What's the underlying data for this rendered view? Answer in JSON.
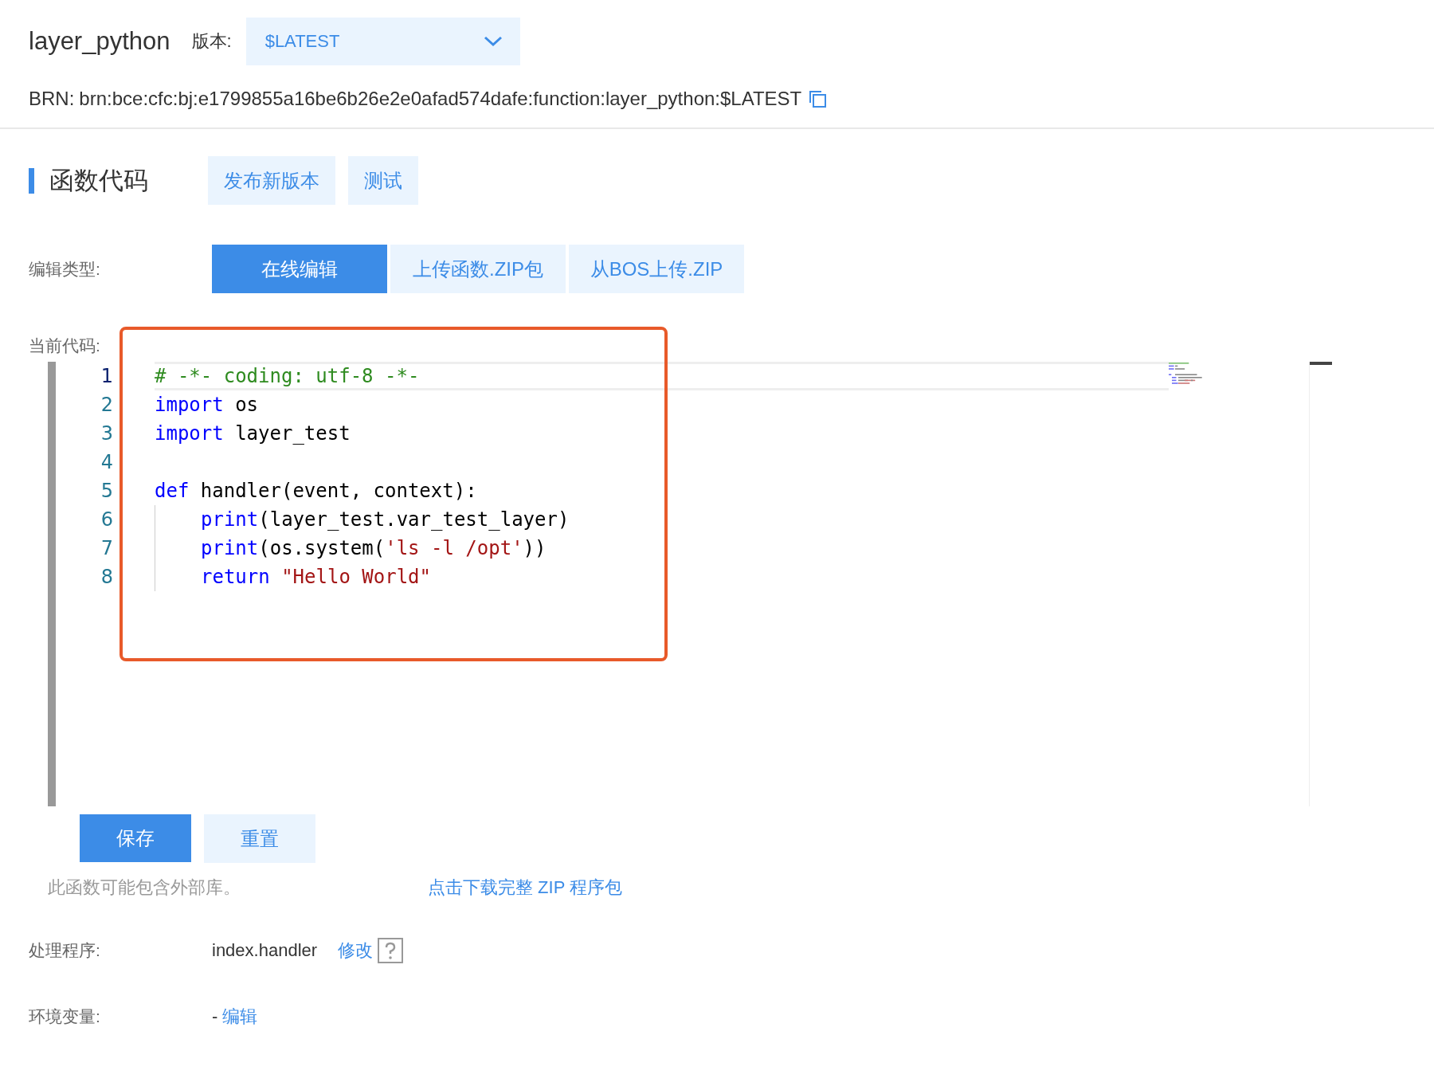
{
  "header": {
    "function_name": "layer_python",
    "version_label": "版本:",
    "version": {
      "value": "$LATEST"
    },
    "brn_label": "BRN:",
    "brn": "brn:bce:cfc:bj:e1799855a16be6b26e2e0afad574dafe:function:layer_python:$LATEST"
  },
  "section": {
    "title": "函数代码",
    "actions": [
      "发布新版本",
      "测试"
    ]
  },
  "edit_type": {
    "label": "编辑类型:",
    "tabs": [
      {
        "label": "在线编辑",
        "selected": true
      },
      {
        "label": "上传函数.ZIP包",
        "selected": false
      },
      {
        "label": "从BOS上传.ZIP",
        "selected": false
      }
    ]
  },
  "code": {
    "label": "当前代码:",
    "lines": [
      {
        "number": "1",
        "active": true,
        "indented": false,
        "tokens": [
          {
            "kind": "comment",
            "text": "# -*- coding: utf-8 -*-"
          }
        ]
      },
      {
        "number": "2",
        "active": false,
        "indented": false,
        "tokens": [
          {
            "kind": "keyword",
            "text": "import"
          },
          {
            "kind": "plain",
            "text": " os"
          }
        ]
      },
      {
        "number": "3",
        "active": false,
        "indented": false,
        "tokens": [
          {
            "kind": "keyword",
            "text": "import"
          },
          {
            "kind": "plain",
            "text": " layer_test"
          }
        ]
      },
      {
        "number": "4",
        "active": false,
        "indented": false
      },
      {
        "number": "5",
        "active": false,
        "indented": false,
        "tokens": [
          {
            "kind": "keyword",
            "text": "def"
          },
          {
            "kind": "plain",
            "text": " handler(event, context):"
          }
        ]
      },
      {
        "number": "6",
        "active": false,
        "indented": true,
        "tokens": [
          {
            "kind": "keyword",
            "text": "print"
          },
          {
            "kind": "plain",
            "text": "(layer_test.var_test_layer)"
          }
        ]
      },
      {
        "number": "7",
        "active": false,
        "indented": true,
        "tokens": [
          {
            "kind": "keyword",
            "text": "print"
          },
          {
            "kind": "plain",
            "text": "(os.system("
          },
          {
            "kind": "string",
            "text": "'ls -l /opt'"
          },
          {
            "kind": "plain",
            "text": "))"
          }
        ]
      },
      {
        "number": "8",
        "active": false,
        "indented": true,
        "tokens": [
          {
            "kind": "keyword",
            "text": "return "
          },
          {
            "kind": "string",
            "text": "\"Hello World\""
          }
        ]
      }
    ],
    "buttons": [
      {
        "label": "保存",
        "kind": "primary"
      },
      {
        "label": "重置",
        "kind": "secondary"
      }
    ],
    "note": "此函数可能包含外部库。",
    "download_link": "点击下载完整 ZIP 程序包"
  },
  "handler": {
    "label": "处理程序:",
    "value": "index.handler",
    "edit_link": "修改"
  },
  "env": {
    "label": "环境变量:",
    "value": "-",
    "edit_link": "编辑"
  }
}
